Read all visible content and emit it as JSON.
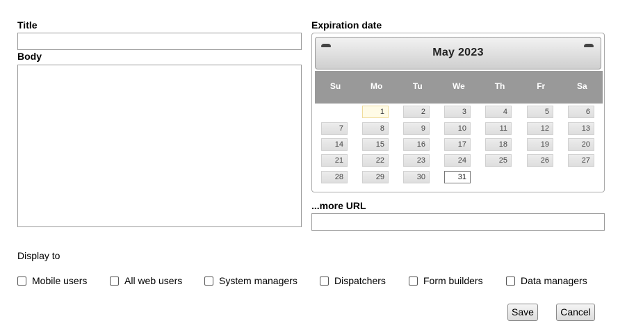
{
  "form": {
    "title_label": "Title",
    "title_value": "",
    "body_label": "Body",
    "body_value": "",
    "expiration_label": "Expiration date",
    "more_url_label": "...more URL",
    "more_url_value": "",
    "display_to_label": "Display to"
  },
  "calendar": {
    "month_title": "May 2023",
    "weekdays": [
      "Su",
      "Mo",
      "Tu",
      "We",
      "Th",
      "Fr",
      "Sa"
    ],
    "first_weekday_index": 1,
    "days_in_month": 31,
    "today": 1,
    "selected": 31,
    "prev_icon": "prev-arrow-icon",
    "next_icon": "next-arrow-icon"
  },
  "display_to": [
    {
      "label": "Mobile users",
      "checked": false
    },
    {
      "label": "All web users",
      "checked": false
    },
    {
      "label": "System managers",
      "checked": false
    },
    {
      "label": "Dispatchers",
      "checked": false
    },
    {
      "label": "Form builders",
      "checked": false
    },
    {
      "label": "Data managers",
      "checked": false
    }
  ],
  "buttons": {
    "save": "Save",
    "cancel": "Cancel"
  }
}
